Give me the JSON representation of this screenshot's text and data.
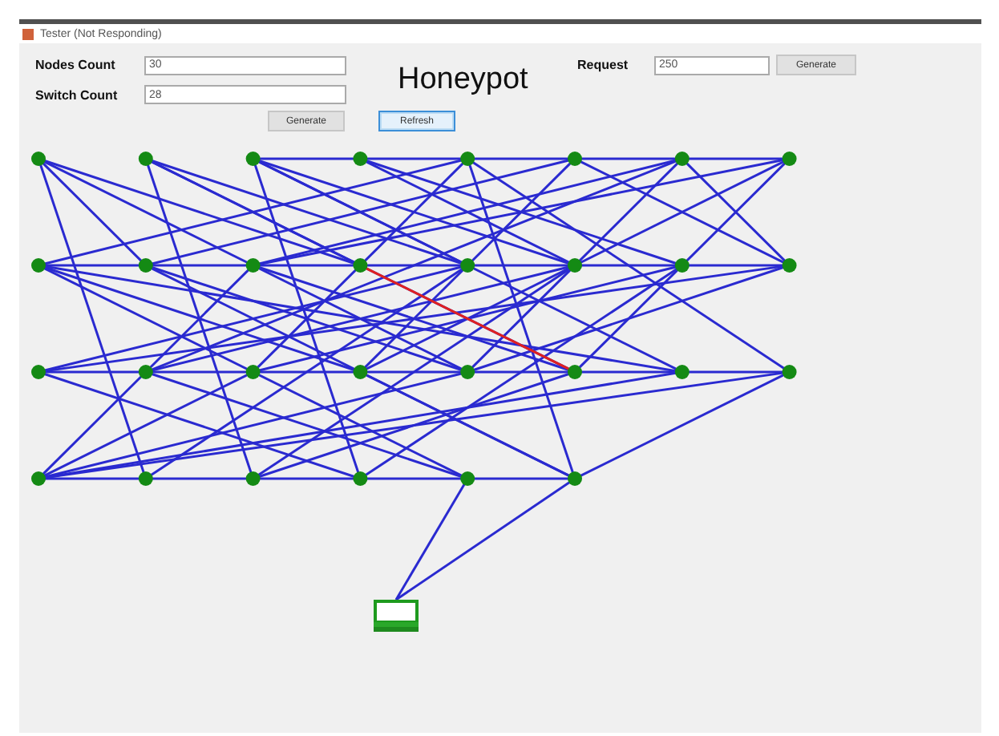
{
  "window": {
    "title": "Tester (Not Responding)"
  },
  "form": {
    "nodes_count": {
      "label": "Nodes Count",
      "value": "30"
    },
    "switch_count": {
      "label": "Switch Count",
      "value": "28"
    },
    "heading": "Honeypot",
    "request": {
      "label": "Request",
      "value": "250"
    },
    "request_button": "Generate",
    "buttons": [
      {
        "label": "Generate",
        "focused": false
      },
      {
        "label": "Refresh",
        "focused": true
      }
    ]
  },
  "network": {
    "rows": [
      {
        "nodes": [
          {
            "kind": "switch"
          },
          {
            "kind": "switch"
          },
          {
            "kind": "switch"
          },
          {
            "kind": "switch"
          },
          {
            "kind": "switch"
          },
          {
            "kind": "switch"
          },
          {
            "kind": "switch"
          },
          {
            "kind": "switch"
          }
        ]
      },
      {
        "nodes": [
          {
            "kind": "switch"
          },
          {
            "kind": "switch"
          },
          {
            "kind": "switch"
          },
          {
            "kind": "switch"
          },
          {
            "kind": "switch"
          },
          {
            "kind": "switch"
          },
          {
            "kind": "switch"
          },
          {
            "kind": "switch"
          }
        ]
      },
      {
        "nodes": [
          {
            "kind": "switch"
          },
          {
            "kind": "switch"
          },
          {
            "kind": "switch"
          },
          {
            "kind": "switch"
          },
          {
            "kind": "switch"
          },
          {
            "kind": "switch"
          },
          {
            "kind": "switch"
          },
          {
            "kind": "switch"
          }
        ]
      },
      {
        "nodes": [
          {
            "kind": "switch"
          },
          {
            "kind": "switch"
          },
          {
            "kind": "switch"
          },
          {
            "kind": "switch"
          },
          {
            "kind": "switch"
          },
          {
            "kind": "switch"
          }
        ]
      }
    ],
    "highlighted_link": {
      "kind": "attack"
    },
    "host": {
      "kind": "computer"
    }
  }
}
